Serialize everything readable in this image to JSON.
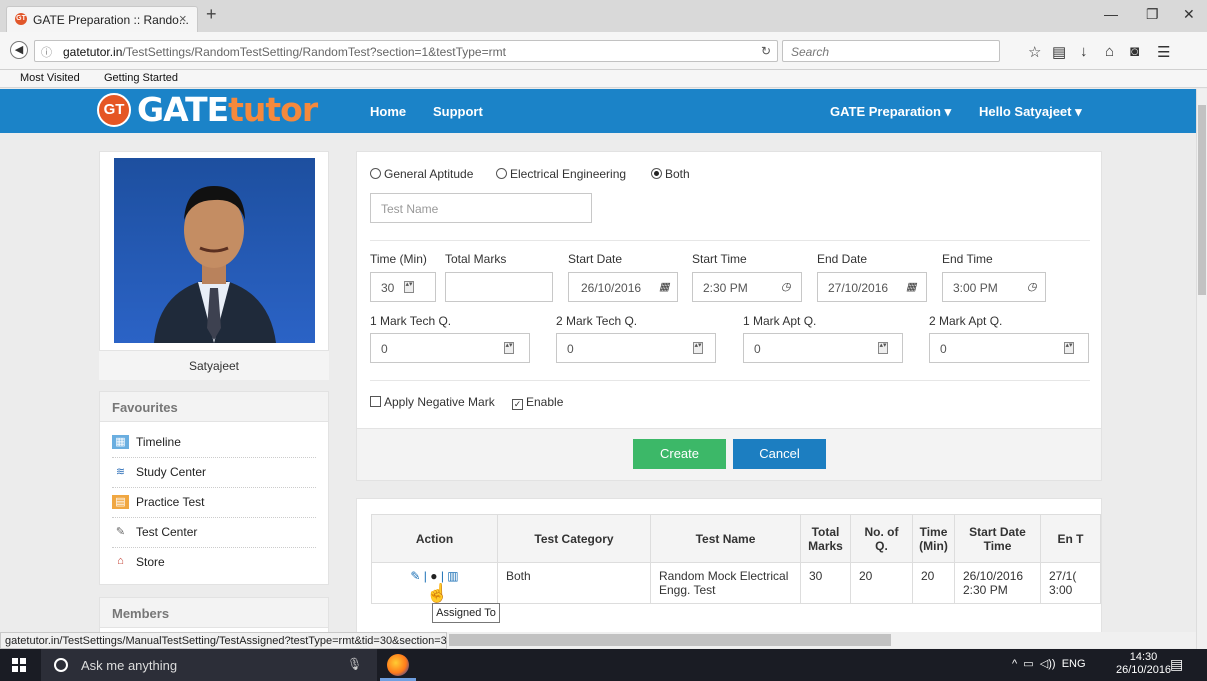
{
  "browser": {
    "tab_title": "GATE Preparation :: Rando...",
    "tab_favicon": "GT",
    "tab_close": "×",
    "new_tab": "+",
    "url_prefix": "gatetutor.in",
    "url_rest": "/TestSettings/RandomTestSetting/RandomTest?section=1&testType=rmt",
    "search_placeholder": "Search",
    "bookmarks": [
      "Most Visited",
      "Getting Started"
    ]
  },
  "site": {
    "logo_badge": "GT",
    "logo_main": "GATE",
    "logo_accent": "tutor",
    "nav": [
      "Home",
      "Support"
    ],
    "nav_right": [
      "GATE Preparation ▾",
      "Hello Satyajeet ▾"
    ]
  },
  "sidebar": {
    "profile_name": "Satyajeet",
    "favourites_title": "Favourites",
    "favourites": [
      "Timeline",
      "Study Center",
      "Practice Test",
      "Test Center",
      "Store"
    ],
    "members_title": "Members"
  },
  "form": {
    "subject_options": [
      "General Aptitude",
      "Electrical Engineering",
      "Both"
    ],
    "selected_subject": "Both",
    "test_name_placeholder": "Test Name",
    "labels": {
      "time": "Time (Min)",
      "total_marks": "Total Marks",
      "start_date": "Start Date",
      "start_time": "Start Time",
      "end_date": "End Date",
      "end_time": "End Time",
      "q1_tech": "1 Mark Tech Q.",
      "q2_tech": "2 Mark Tech Q.",
      "q1_apt": "1 Mark Apt Q.",
      "q2_apt": "2 Mark Apt Q."
    },
    "values": {
      "time": "30",
      "total_marks": "",
      "start_date": "26/10/2016",
      "start_time": "2:30 PM",
      "end_date": "27/10/2016",
      "end_time": "3:00 PM",
      "q1_tech": "0",
      "q2_tech": "0",
      "q1_apt": "0",
      "q2_apt": "0"
    },
    "negative_mark_label": "Apply Negative Mark",
    "enable_label": "Enable",
    "negative_checked": false,
    "enable_checked": true,
    "create_label": "Create",
    "cancel_label": "Cancel",
    "colors": {
      "create": "#3cb868",
      "cancel": "#1c7ec1",
      "header": "#1b83c8"
    }
  },
  "table": {
    "headers": [
      "Action",
      "Test Category",
      "Test Name",
      "Total Marks",
      "No. of Q.",
      "Time (Min)",
      "Start Date Time",
      "En T"
    ],
    "rows": [
      {
        "category": "Both",
        "name": "Random Mock Electrical Engg. Test",
        "total_marks": "30",
        "num_q": "20",
        "time": "20",
        "start": "26/10/2016 2:30 PM",
        "end": "27/1( 3:00"
      }
    ],
    "tooltip": "Assigned To"
  },
  "status": {
    "link": "gatetutor.in/TestSettings/ManualTestSetting/TestAssigned?testType=rmt&tid=30&section=3"
  },
  "taskbar": {
    "search_text": "Ask me anything",
    "tray_text": "ENG",
    "time": "14:30",
    "date": "26/10/2016"
  }
}
